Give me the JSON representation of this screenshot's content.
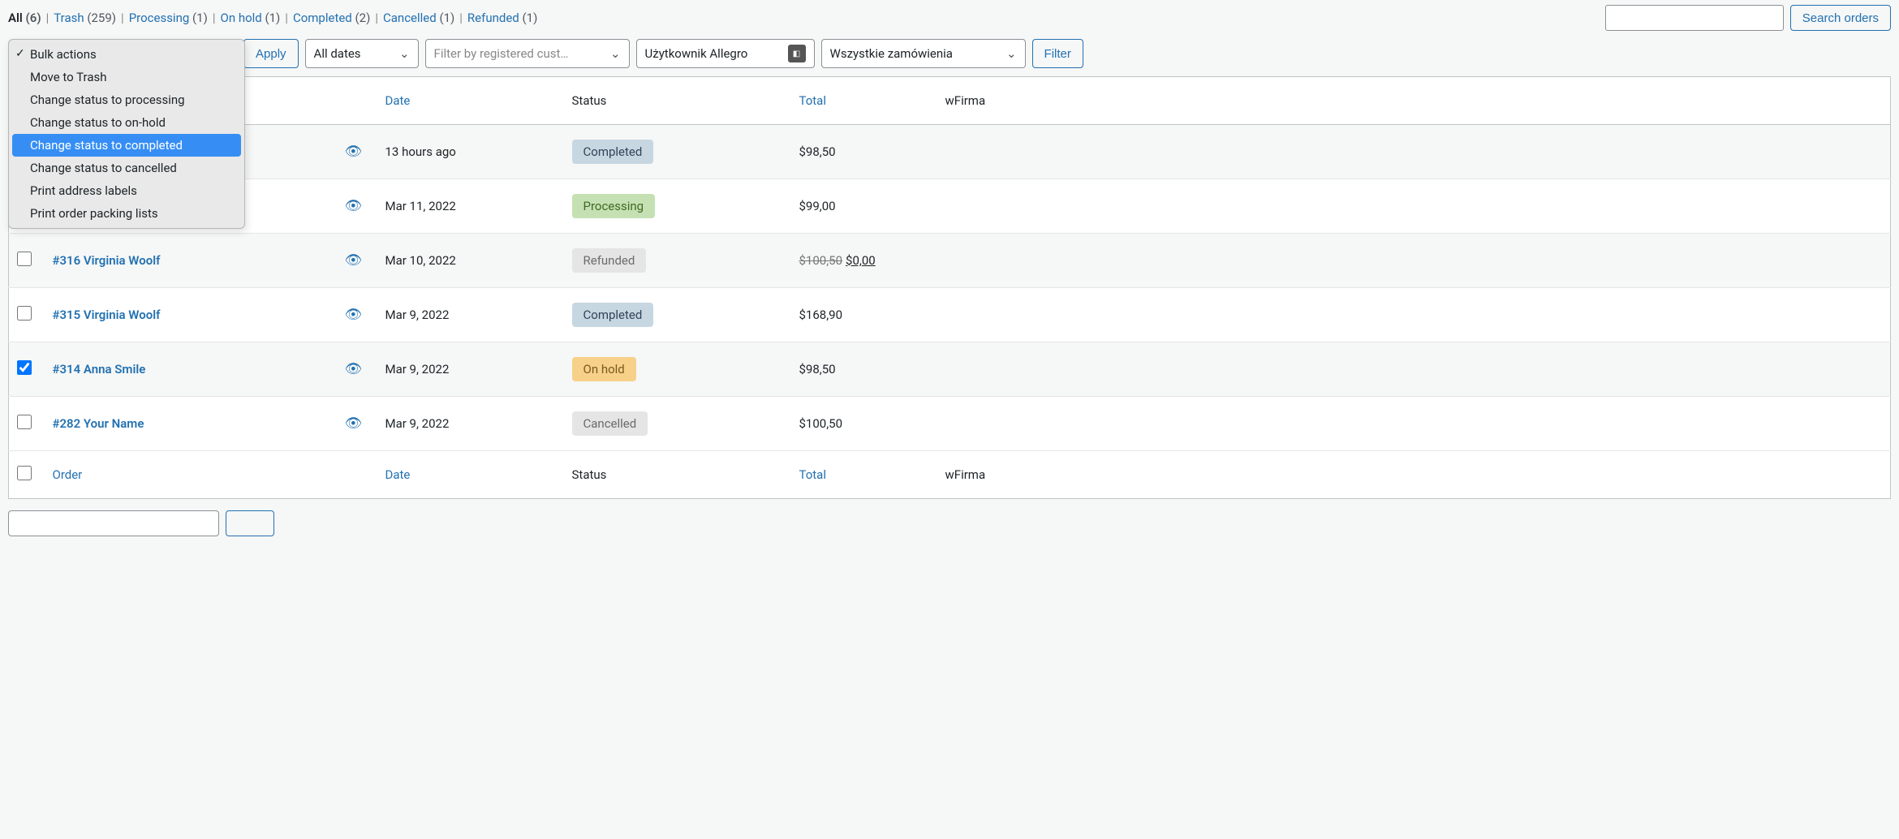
{
  "status_filters": [
    {
      "label": "All",
      "count": "(6)",
      "current": true
    },
    {
      "label": "Trash",
      "count": "(259)"
    },
    {
      "label": "Processing",
      "count": "(1)"
    },
    {
      "label": "On hold",
      "count": "(1)"
    },
    {
      "label": "Completed",
      "count": "(2)"
    },
    {
      "label": "Cancelled",
      "count": "(1)"
    },
    {
      "label": "Refunded",
      "count": "(1)"
    }
  ],
  "search_button": "Search orders",
  "bulk_actions": {
    "options": [
      {
        "label": "Bulk actions",
        "checked": true
      },
      {
        "label": "Move to Trash"
      },
      {
        "label": "Change status to processing"
      },
      {
        "label": "Change status to on-hold"
      },
      {
        "label": "Change status to completed",
        "highlight": true
      },
      {
        "label": "Change status to cancelled"
      },
      {
        "label": "Print address labels"
      },
      {
        "label": "Print order packing lists"
      }
    ],
    "apply_label": "Apply"
  },
  "filters": {
    "dates": "All dates",
    "customer_placeholder": "Filter by registered cust…",
    "allegro_user": "Użytkownik Allegro",
    "all_orders": "Wszystkie zamówienia",
    "filter_button": "Filter"
  },
  "columns": {
    "order": "Order",
    "date": "Date",
    "status": "Status",
    "total": "Total",
    "wfirma": "wFirma"
  },
  "rows": [
    {
      "checked": false,
      "order": "",
      "date": "13 hours ago",
      "status": "Completed",
      "status_class": "st-completed",
      "total": "$98,50",
      "refund": null
    },
    {
      "checked": false,
      "order": "",
      "date": "Mar 11, 2022",
      "status": "Processing",
      "status_class": "st-processing",
      "total": "$99,00",
      "refund": null
    },
    {
      "checked": false,
      "order": "#316 Virginia Woolf",
      "date": "Mar 10, 2022",
      "status": "Refunded",
      "status_class": "st-refunded",
      "total_strike": "$100,50",
      "total": "$0,00",
      "refund": true
    },
    {
      "checked": false,
      "order": "#315 Virginia Woolf",
      "date": "Mar 9, 2022",
      "status": "Completed",
      "status_class": "st-completed",
      "total": "$168,90",
      "refund": null
    },
    {
      "checked": true,
      "order": "#314 Anna Smile",
      "date": "Mar 9, 2022",
      "status": "On hold",
      "status_class": "st-onhold",
      "total": "$98,50",
      "refund": null
    },
    {
      "checked": false,
      "order": "#282 Your Name",
      "date": "Mar 9, 2022",
      "status": "Cancelled",
      "status_class": "st-cancelled",
      "total": "$100,50",
      "refund": null
    }
  ]
}
